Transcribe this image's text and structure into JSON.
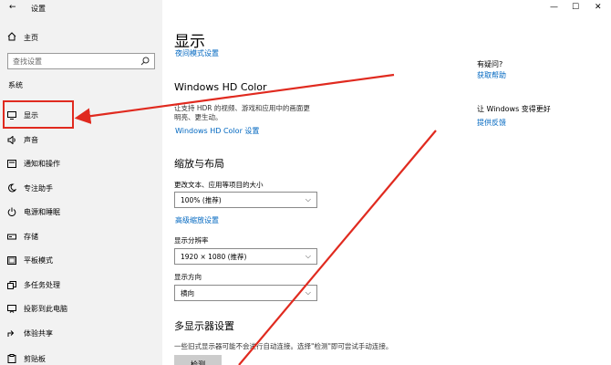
{
  "window": {
    "title": "设置",
    "minimize": "—",
    "maximize": "☐",
    "close": "✕"
  },
  "sidebar": {
    "home_label": "主页",
    "search_placeholder": "查找设置",
    "section": "系统",
    "items": [
      {
        "label": "显示",
        "icon": "monitor-icon"
      },
      {
        "label": "声音",
        "icon": "speaker-icon"
      },
      {
        "label": "通知和操作",
        "icon": "notification-icon"
      },
      {
        "label": "专注助手",
        "icon": "moon-icon"
      },
      {
        "label": "电源和睡眠",
        "icon": "power-icon"
      },
      {
        "label": "存储",
        "icon": "storage-icon"
      },
      {
        "label": "平板模式",
        "icon": "tablet-icon"
      },
      {
        "label": "多任务处理",
        "icon": "multitask-icon"
      },
      {
        "label": "投影到此电脑",
        "icon": "project-icon"
      },
      {
        "label": "体验共享",
        "icon": "share-icon"
      },
      {
        "label": "剪贴板",
        "icon": "clipboard-icon"
      }
    ]
  },
  "main": {
    "title": "显示",
    "night_light_link": "夜间模式设置",
    "hd_color": {
      "heading": "Windows HD Color",
      "desc_line1": "让支持 HDR 的视频、游戏和应用中的画面更",
      "desc_line2": "明亮、更生动。",
      "link": "Windows HD Color 设置"
    },
    "scale": {
      "heading": "缩放与布局",
      "text_size_label": "更改文本、应用等项目的大小",
      "text_size_value": "100% (推荐)",
      "advanced_link": "高级缩放设置",
      "resolution_label": "显示分辨率",
      "resolution_value": "1920 × 1080 (推荐)",
      "orientation_label": "显示方向",
      "orientation_value": "横向"
    },
    "multi_display": {
      "heading": "多显示器设置",
      "desc": "一些旧式显示器可能不会进行自动连接。选择\"检测\"即可尝试手动连接。",
      "detect_button": "检测"
    }
  },
  "right": {
    "question": "有疑问?",
    "get_help": "获取帮助",
    "feedback_heading": "让 Windows 变得更好",
    "feedback_link": "提供反馈"
  },
  "colors": {
    "accent": "#0067c0",
    "annotation": "#e02a1f"
  }
}
